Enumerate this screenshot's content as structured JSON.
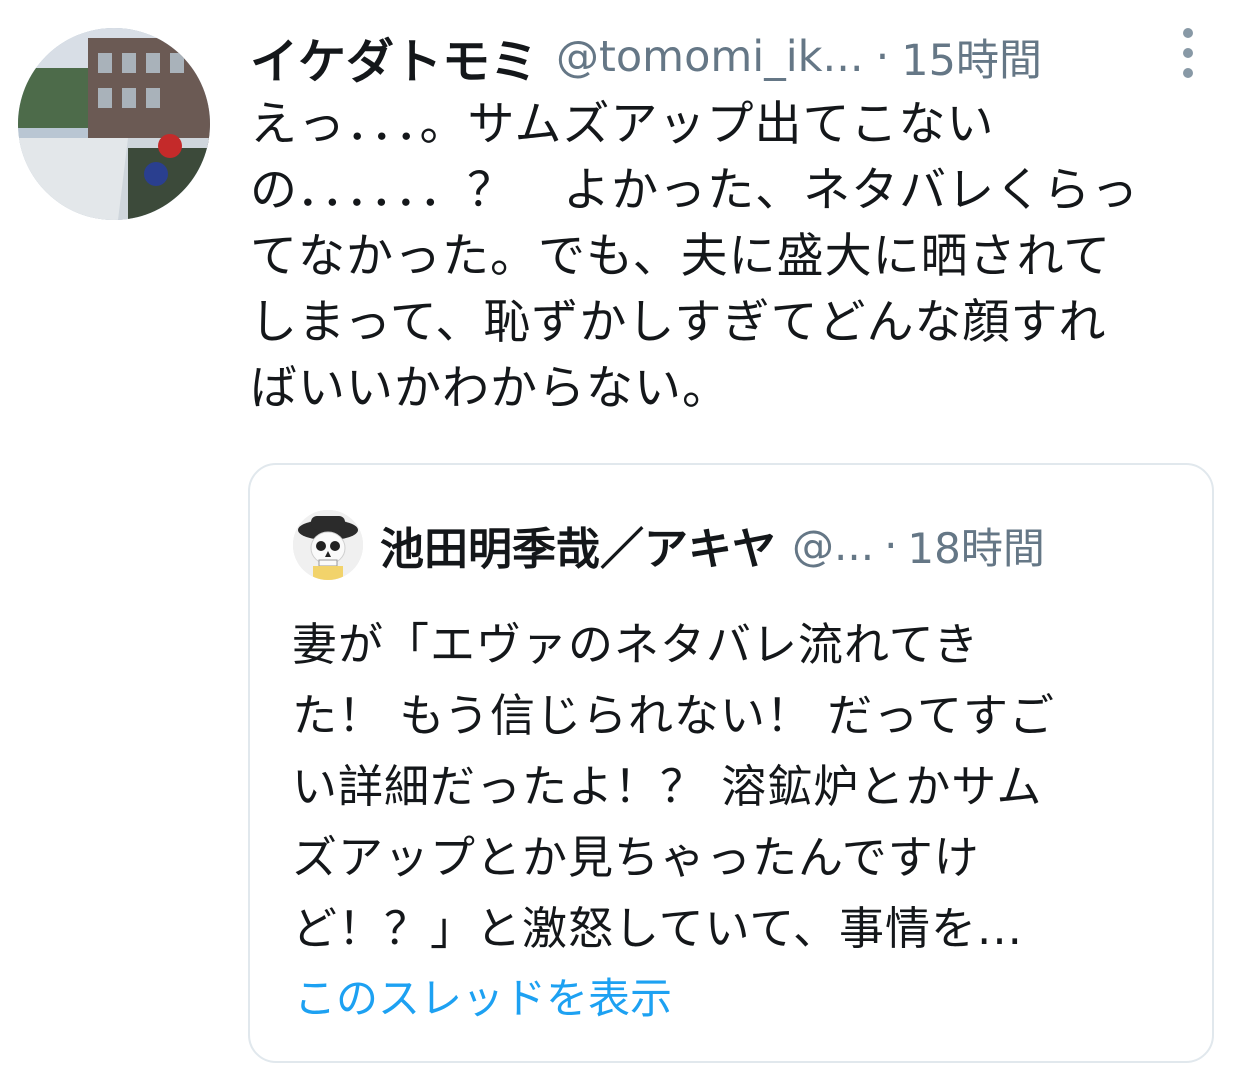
{
  "tweet": {
    "author_name": "イケダトモミ",
    "author_handle": "@tomomi_ik...",
    "separator": "·",
    "time": "15時間",
    "body_lines": [
      "えっ．．．。サムズアップ出てこない",
      "の．．．．．．？　よかった、ネタバレくらっ",
      "てなかった。でも、夫に盛大に晒されて",
      "しまって、恥ずかしすぎてどんな顔すれ",
      "ばいいかわからない。"
    ],
    "more_icon": "more-vertical-icon"
  },
  "quoted": {
    "author_name": "池田明季哉／アキヤ",
    "author_handle": "@...",
    "separator": "·",
    "time": "18時間",
    "body_lines": [
      "妻が「エヴァのネタバレ流れてき",
      "た！ もう信じられない！ だってすご",
      "い詳細だったよ！？ 溶鉱炉とかサム",
      "ズアップとか見ちゃったんですけ",
      "ど！？」と激怒していて、事情を..."
    ],
    "show_thread": "このスレッドを表示"
  },
  "colors": {
    "text": "#14171a",
    "muted": "#657786",
    "link": "#1da1f2",
    "border": "#e1e8ed"
  }
}
